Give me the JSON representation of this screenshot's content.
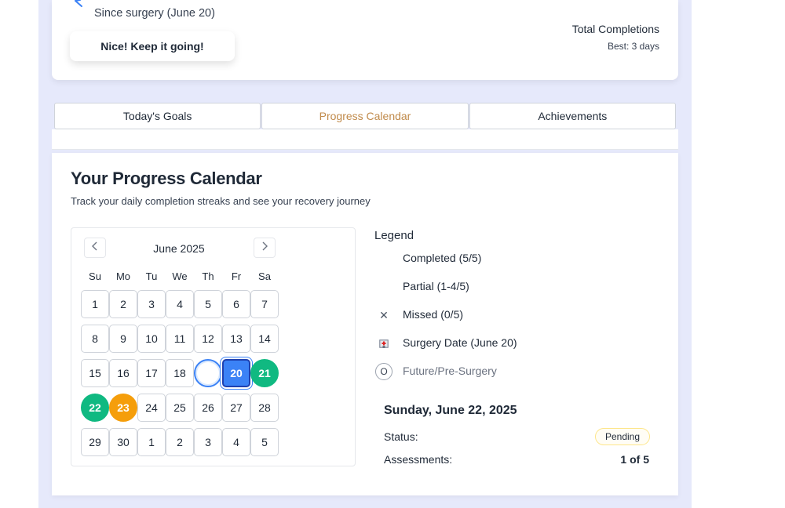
{
  "header": {
    "since_text": "Since surgery (June 20)",
    "cheer_text": "Nice! Keep it going!",
    "total_label": "Total Completions",
    "best_label": "Best: 3 days"
  },
  "tabs": [
    {
      "label": "Today's Goals",
      "active": false
    },
    {
      "label": "Progress Calendar",
      "active": true
    },
    {
      "label": "Achievements",
      "active": false
    }
  ],
  "calendar_page": {
    "title": "Your Progress Calendar",
    "subtitle": "Track your daily completion streaks and see your recovery journey"
  },
  "calendar": {
    "month_label": "June 2025",
    "weekdays": [
      "Su",
      "Mo",
      "Tu",
      "We",
      "Th",
      "Fr",
      "Sa"
    ],
    "weeks": [
      [
        {
          "d": "1",
          "s": "plain"
        },
        {
          "d": "2",
          "s": "plain"
        },
        {
          "d": "3",
          "s": "plain"
        },
        {
          "d": "4",
          "s": "plain"
        },
        {
          "d": "5",
          "s": "plain"
        },
        {
          "d": "6",
          "s": "plain"
        },
        {
          "d": "7",
          "s": "plain"
        }
      ],
      [
        {
          "d": "8",
          "s": "plain"
        },
        {
          "d": "9",
          "s": "plain"
        },
        {
          "d": "10",
          "s": "plain"
        },
        {
          "d": "11",
          "s": "plain"
        },
        {
          "d": "12",
          "s": "plain"
        },
        {
          "d": "13",
          "s": "plain"
        },
        {
          "d": "14",
          "s": "plain"
        }
      ],
      [
        {
          "d": "15",
          "s": "plain"
        },
        {
          "d": "16",
          "s": "plain"
        },
        {
          "d": "17",
          "s": "plain"
        },
        {
          "d": "18",
          "s": "plain"
        },
        {
          "d": "",
          "s": "today-ring"
        },
        {
          "d": "20",
          "s": "surgery"
        },
        {
          "d": "21",
          "s": "completed"
        }
      ],
      [
        {
          "d": "22",
          "s": "completed"
        },
        {
          "d": "23",
          "s": "partial"
        },
        {
          "d": "24",
          "s": "plain"
        },
        {
          "d": "25",
          "s": "plain"
        },
        {
          "d": "26",
          "s": "plain"
        },
        {
          "d": "27",
          "s": "plain"
        },
        {
          "d": "28",
          "s": "plain"
        }
      ],
      [
        {
          "d": "29",
          "s": "plain"
        },
        {
          "d": "30",
          "s": "plain"
        },
        {
          "d": "1",
          "s": "plain"
        },
        {
          "d": "2",
          "s": "plain"
        },
        {
          "d": "3",
          "s": "plain"
        },
        {
          "d": "4",
          "s": "plain"
        },
        {
          "d": "5",
          "s": "plain"
        }
      ]
    ]
  },
  "legend": {
    "title": "Legend",
    "items": [
      {
        "icon": "none",
        "label": "Completed (5/5)"
      },
      {
        "icon": "none",
        "label": "Partial (1-4/5)"
      },
      {
        "icon": "x-icon",
        "glyph": "✕",
        "label": "Missed (0/5)"
      },
      {
        "icon": "hospital-icon",
        "label": "Surgery Date (June 20)"
      },
      {
        "icon": "future-circle-icon",
        "glyph": "O",
        "label": "Future/Pre-Surgery"
      }
    ]
  },
  "detail": {
    "date": "Sunday, June 22, 2025",
    "status_label": "Status:",
    "status_value": "Pending",
    "assessments_label": "Assessments:",
    "assessments_value": "1 of 5"
  },
  "colors": {
    "completed": "#10b981",
    "partial": "#f59e0b",
    "surgery": "#3b82f6",
    "active_tab": "#c08a4a",
    "page_bg": "#e6e9fb"
  }
}
